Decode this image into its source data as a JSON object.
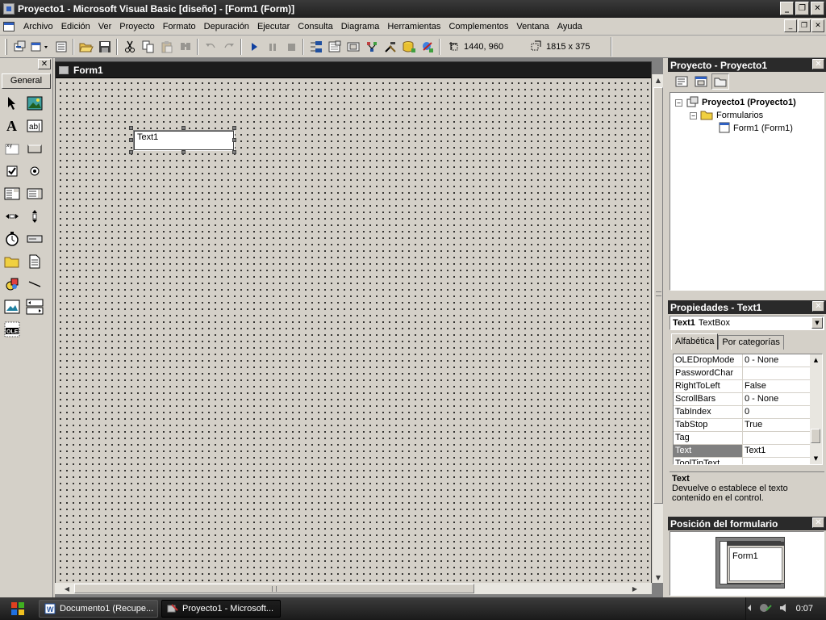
{
  "window": {
    "title": "Proyecto1 - Microsoft Visual Basic [diseño] - [Form1 (Form)]",
    "min_btn": "_",
    "restore_btn": "❐",
    "close_btn": "✕"
  },
  "menubar": {
    "items": [
      "Archivo",
      "Edición",
      "Ver",
      "Proyecto",
      "Formato",
      "Depuración",
      "Ejecutar",
      "Consulta",
      "Diagrama",
      "Herramientas",
      "Complementos",
      "Ventana",
      "Ayuda"
    ]
  },
  "toolbar": {
    "position": "1440, 960",
    "size": "1815 x 375"
  },
  "toolbox": {
    "tab_label": "General"
  },
  "form": {
    "caption": "Form1",
    "textbox_text": "Text1"
  },
  "project": {
    "title": "Proyecto - Proyecto1",
    "root": "Proyecto1 (Proyecto1)",
    "folder": "Formularios",
    "item": "Form1 (Form1)",
    "expand_glyph": "−"
  },
  "properties": {
    "title": "Propiedades - Text1",
    "object_name": "Text1",
    "object_type": "TextBox",
    "tabs": [
      "Alfabética",
      "Por categorías"
    ],
    "rows": [
      {
        "name": "OLEDropMode",
        "value": "0 - None"
      },
      {
        "name": "PasswordChar",
        "value": ""
      },
      {
        "name": "RightToLeft",
        "value": "False"
      },
      {
        "name": "ScrollBars",
        "value": "0 - None"
      },
      {
        "name": "TabIndex",
        "value": "0"
      },
      {
        "name": "TabStop",
        "value": "True"
      },
      {
        "name": "Tag",
        "value": ""
      },
      {
        "name": "Text",
        "value": "Text1"
      },
      {
        "name": "ToolTipText",
        "value": ""
      }
    ],
    "selected_row": "Text",
    "desc_title": "Text",
    "desc_body": "Devuelve o establece el texto contenido en el control."
  },
  "form_layout": {
    "title": "Posición del formulario",
    "form_label": "Form1"
  },
  "taskbar": {
    "buttons": [
      "Documento1 (Recupe...",
      "Proyecto1 - Microsoft..."
    ],
    "active_index": 1,
    "clock": "0:07"
  },
  "colors": {
    "titlebar": "#1f1f1f",
    "panel_bg": "#d4d0c8",
    "selected_prop": "#808080"
  }
}
